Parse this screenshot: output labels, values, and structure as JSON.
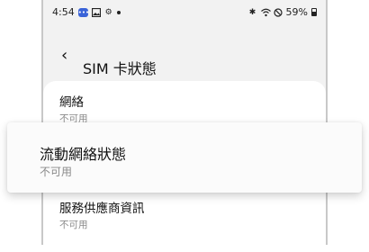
{
  "status_bar": {
    "time": "4:54",
    "battery_text": "59%",
    "icons_left": [
      "message-icon",
      "gallery-icon",
      "settings-gear-icon",
      "dot-icon"
    ],
    "icons_right": [
      "bluetooth-icon",
      "wifi-icon",
      "do-not-disturb-icon",
      "battery-icon"
    ]
  },
  "header": {
    "back_icon": "‹",
    "title": "SIM 卡狀態"
  },
  "items": [
    {
      "title": "網絡",
      "subtitle": "不可用"
    },
    {
      "title": "流動網絡狀態",
      "subtitle": "不可用"
    },
    {
      "title": "服務供應商資訊",
      "subtitle": "不可用"
    }
  ]
}
